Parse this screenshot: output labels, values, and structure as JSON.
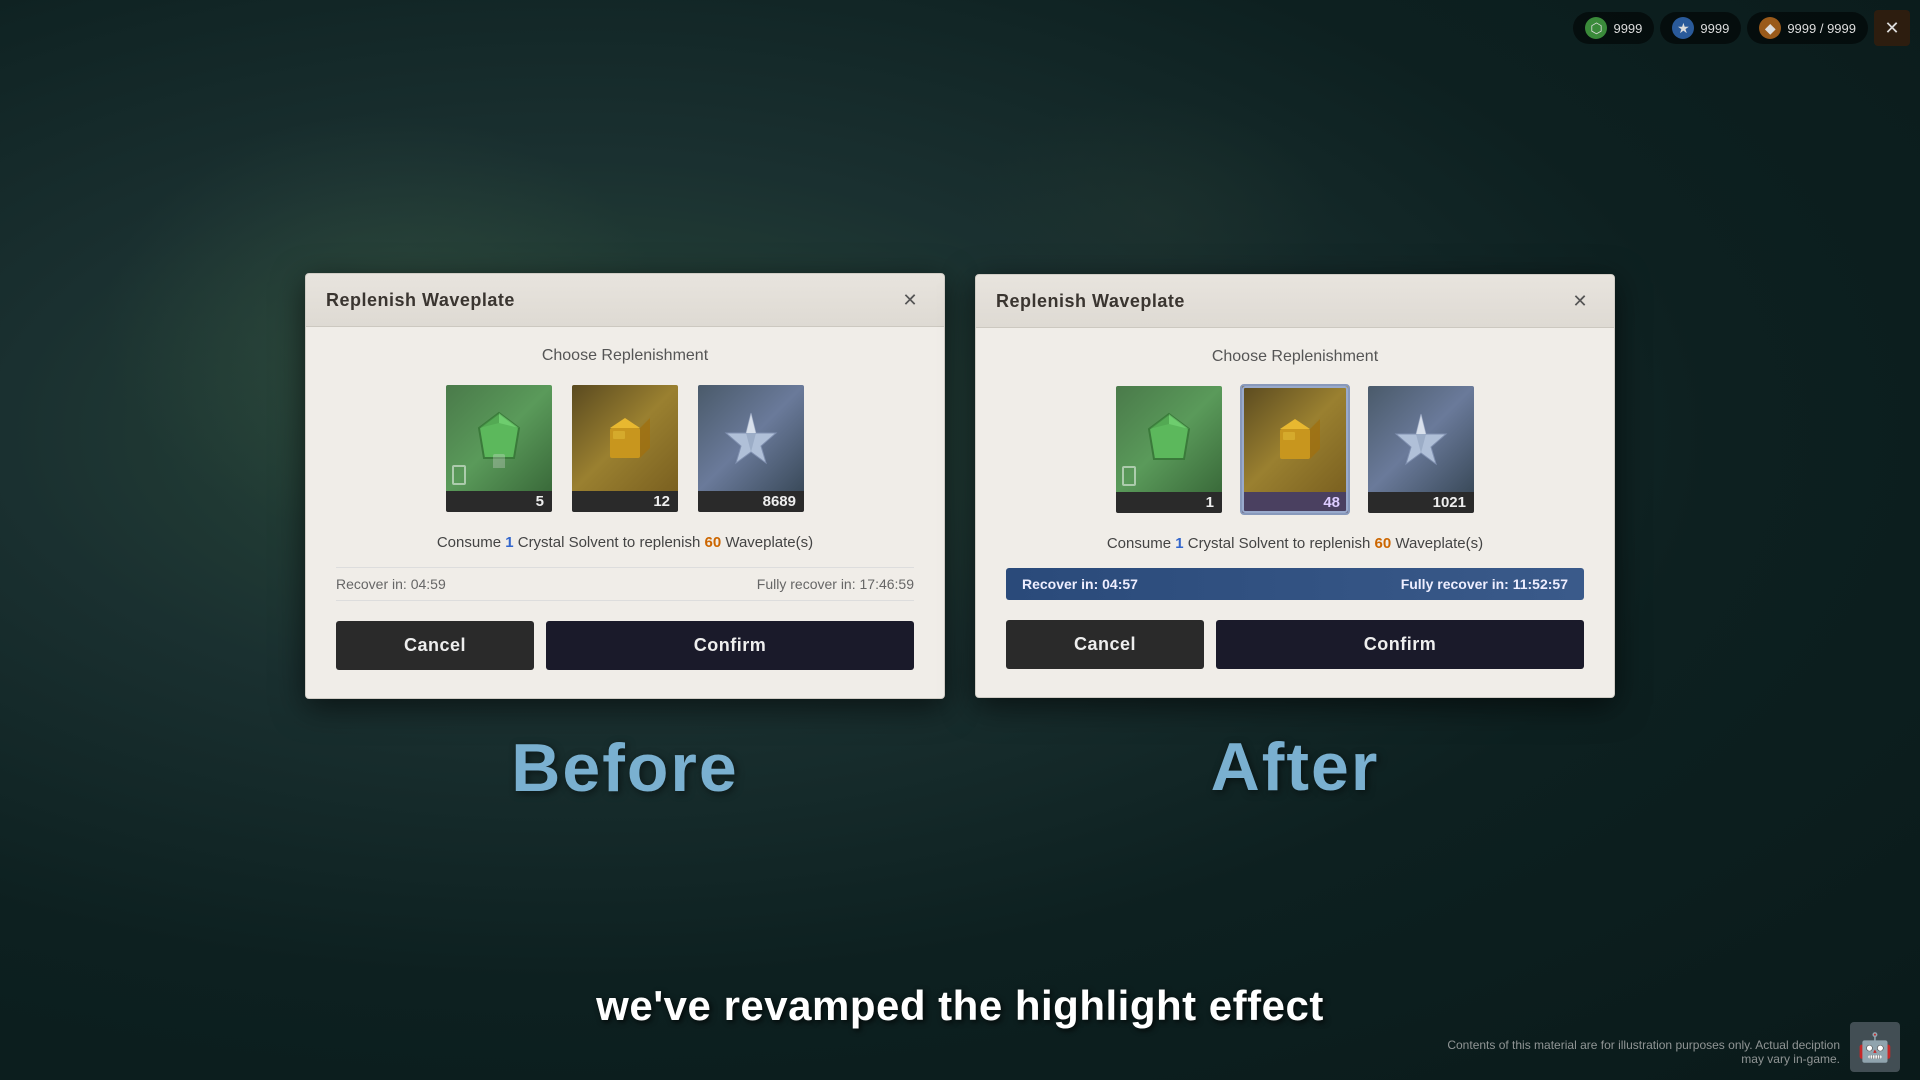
{
  "background": {
    "color": "#1a2a2a"
  },
  "hud": {
    "pill1": {
      "icon": "⬡",
      "value": "9999",
      "iconColor": "green"
    },
    "pill2": {
      "icon": "★",
      "value": "9999",
      "iconColor": "blue"
    },
    "pill3": {
      "icon": "◆",
      "value": "9999 / 9999",
      "iconColor": "orange"
    },
    "closeIcon": "✕"
  },
  "before_panel": {
    "dialog": {
      "title": "Replenish Waveplate",
      "close_icon": "✕",
      "section_label": "Choose Replenishment",
      "items": [
        {
          "id": "green-gem",
          "type": "green-gem",
          "count": "5",
          "selected": false
        },
        {
          "id": "gold-cube",
          "type": "gold-cube",
          "count": "12",
          "selected": false
        },
        {
          "id": "crystal",
          "type": "crystal",
          "count": "8689",
          "selected": false
        }
      ],
      "consume_text_prefix": "Consume ",
      "consume_num": "1",
      "consume_text_mid": " Crystal Solvent to replenish ",
      "consume_waveplate": "60",
      "consume_text_suffix": " Waveplate(s)",
      "timer_recover": "Recover in: 04:59",
      "timer_full": "Fully recover in: 17:46:59",
      "cancel_label": "Cancel",
      "confirm_label": "Confirm"
    },
    "section_label": "Before"
  },
  "after_panel": {
    "dialog": {
      "title": "Replenish Waveplate",
      "close_icon": "✕",
      "section_label": "Choose Replenishment",
      "items": [
        {
          "id": "green-gem",
          "type": "green-gem",
          "count": "1",
          "selected": false
        },
        {
          "id": "gold-cube",
          "type": "gold-cube",
          "count": "48",
          "selected": true
        },
        {
          "id": "crystal",
          "type": "crystal",
          "count": "1021",
          "selected": false
        }
      ],
      "consume_text_prefix": "Consume ",
      "consume_num": "1",
      "consume_text_mid": " Crystal Solvent to replenish ",
      "consume_waveplate": "60",
      "consume_text_suffix": " Waveplate(s)",
      "timer_recover": "Recover in: 04:57",
      "timer_full": "Fully recover in: 11:52:57",
      "cancel_label": "Cancel",
      "confirm_label": "Confirm",
      "timer_highlighted": true
    },
    "section_label": "After"
  },
  "subtitle": "we've revamped the highlight effect",
  "disclaimer": "Contents of this material are for illustration purposes only. Actual deciption may vary in-game."
}
